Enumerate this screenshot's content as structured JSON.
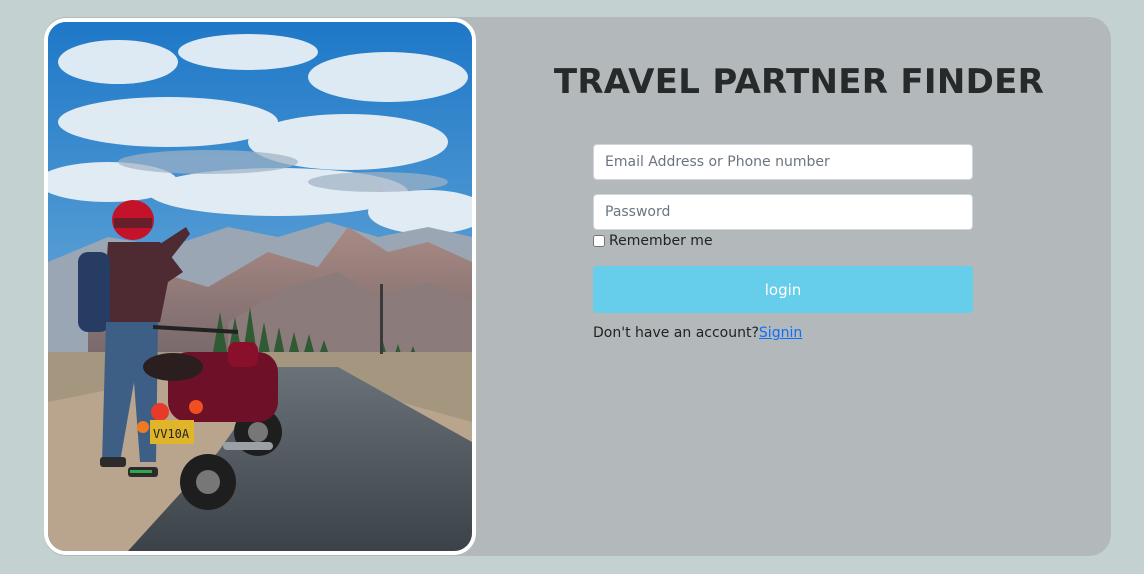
{
  "page": {
    "title": "TRAVEL PARTNER FINDER",
    "background_color": "#c4d1d1",
    "card_color": "#b3b8ba"
  },
  "hero_image": {
    "subject": "motorcyclist-overlooking-mountain-road",
    "plate_text": "VV10A"
  },
  "form": {
    "email_placeholder": "Email Address or Phone number",
    "password_placeholder": "Password",
    "remember_label": "Remember me",
    "remember_checked": false,
    "login_label": "login",
    "login_color": "#66cdea",
    "no_account_text": "Don't have an account?",
    "signin_link": "Signin",
    "link_color": "#0d6efd"
  }
}
